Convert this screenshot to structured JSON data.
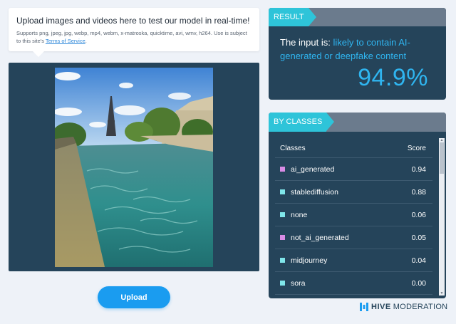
{
  "upload_info": {
    "title": "Upload images and videos here to test our model in real-time!",
    "supported_prefix": "Supports png, jpeg, jpg, webp, mp4, webm, x-matroska, quicktime, avi, wmv, h264. Use is subject to this site's ",
    "tos_link": "Terms of Service",
    "tos_suffix": "."
  },
  "upload_button": "Upload",
  "result": {
    "header": "RESULT",
    "prefix": "The input is: ",
    "verdict": "likely to contain AI-generated or deepfake content",
    "score": "94.9%"
  },
  "classes": {
    "header": "BY CLASSES",
    "col_classes": "Classes",
    "col_score": "Score",
    "rows": [
      {
        "name": "ai_generated",
        "score": "0.94",
        "color": "#d98ce6"
      },
      {
        "name": "stablediffusion",
        "score": "0.88",
        "color": "#7fe6ea"
      },
      {
        "name": "none",
        "score": "0.06",
        "color": "#7fe6ea"
      },
      {
        "name": "not_ai_generated",
        "score": "0.05",
        "color": "#d98ce6"
      },
      {
        "name": "midjourney",
        "score": "0.04",
        "color": "#7fe6ea"
      },
      {
        "name": "sora",
        "score": "0.00",
        "color": "#7fe6ea"
      }
    ]
  },
  "brand": {
    "bold": "HIVE",
    "light": "MODERATION",
    "icon": "hive-bars-icon"
  },
  "colors": {
    "accent": "#2fb5f0",
    "panel": "#25445a",
    "tag": "#2ec4d9",
    "button": "#1a9cf0"
  }
}
